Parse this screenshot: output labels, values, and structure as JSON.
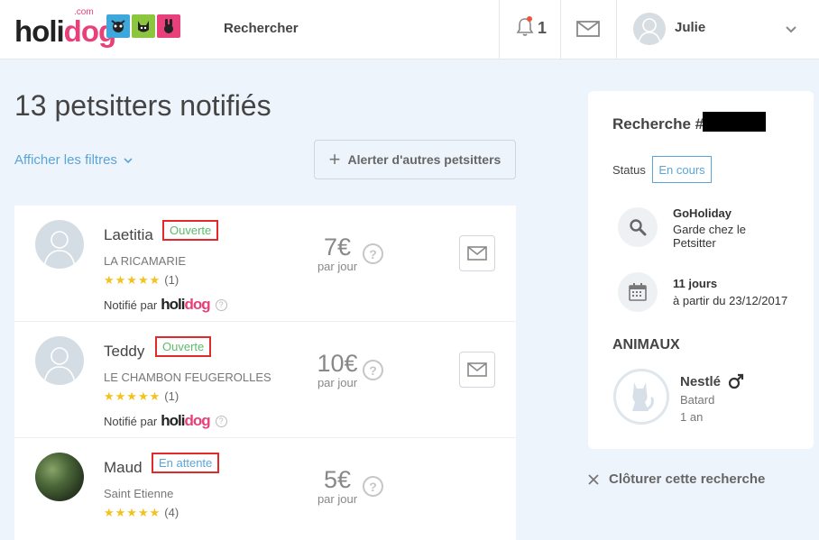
{
  "header": {
    "logo_main": "holi",
    "logo_accent": "dog",
    "logo_suffix": ".com",
    "nav_search": "Rechercher",
    "notif_count": "1",
    "user_name": "Julie"
  },
  "page": {
    "title": "13 petsitters notifiés",
    "filters_label": "Afficher les filtres",
    "alert_button": "Alerter d'autres petsitters"
  },
  "sitters": [
    {
      "name": "Laetitia",
      "status": "Ouverte",
      "city": "LA RICAMARIE",
      "stars": "★★★★★",
      "reviews": "(1)",
      "notified_label": "Notifié par",
      "price": "7€",
      "per_day": "par jour"
    },
    {
      "name": "Teddy",
      "status": "Ouverte",
      "city": "LE CHAMBON FEUGEROLLES",
      "stars": "★★★★★",
      "reviews": "(1)",
      "notified_label": "Notifié par",
      "price": "10€",
      "per_day": "par jour"
    },
    {
      "name": "Maud",
      "status": "En attente",
      "city": "Saint Etienne",
      "stars": "★★★★★",
      "reviews": "(4)",
      "price": "5€",
      "per_day": "par jour"
    }
  ],
  "panel": {
    "title": "Recherche #",
    "status_label": "Status",
    "status_value": "En cours",
    "service_title": "GoHoliday",
    "service_desc_1": "Garde chez le",
    "service_desc_2": "Petsitter",
    "duration": "11 jours",
    "start": "à partir du 23/12/2017",
    "animals_heading": "ANIMAUX",
    "pet_name": "Nestlé",
    "pet_breed": "Batard",
    "pet_age": "1 an"
  },
  "close_search_label": "Clôturer cette recherche",
  "colors": {
    "accent_blue": "#5ba4d8",
    "open_green": "#5cbb6c",
    "brand_pink": "#e8407a",
    "star_yellow": "#f3c21d",
    "highlight_red": "#e22a2a"
  }
}
